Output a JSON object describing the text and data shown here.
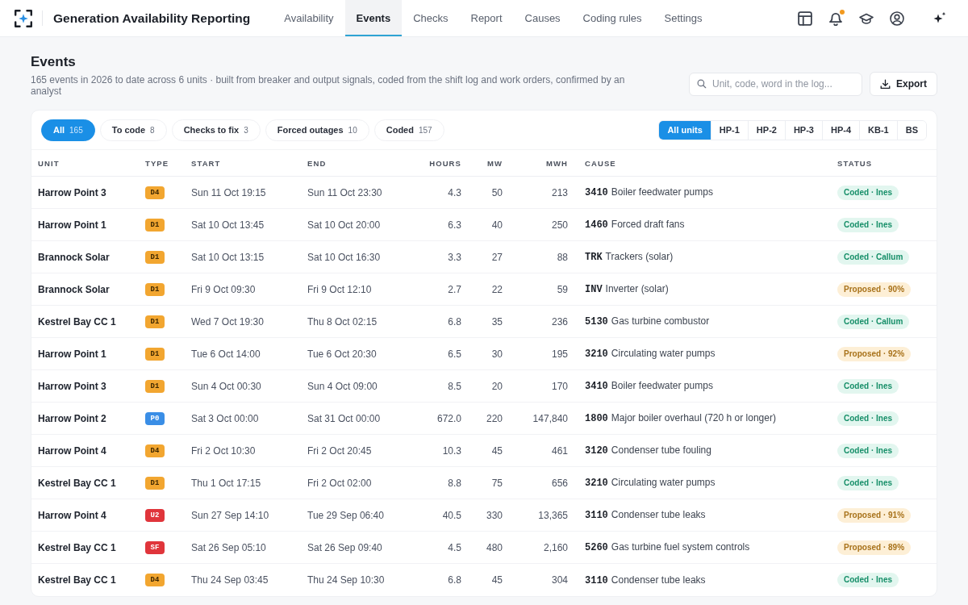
{
  "app": {
    "title": "Generation Availability Reporting",
    "notifications_unread": true
  },
  "nav": [
    {
      "label": "Availability",
      "selected": false
    },
    {
      "label": "Events",
      "selected": true
    },
    {
      "label": "Checks",
      "selected": false
    },
    {
      "label": "Report",
      "selected": false
    },
    {
      "label": "Causes",
      "selected": false
    },
    {
      "label": "Coding rules",
      "selected": false
    },
    {
      "label": "Settings",
      "selected": false
    }
  ],
  "page": {
    "title": "Events",
    "subtitle": "165 events in 2026 to date across 6 units · built from breaker and output signals, coded from the shift log and work orders, confirmed by an analyst",
    "search": {
      "placeholder": "Unit, code, word in the log..."
    },
    "export_button": "Export"
  },
  "filters": [
    {
      "label": "All",
      "count": "165",
      "selected": true
    },
    {
      "label": "To code",
      "count": "8",
      "selected": false
    },
    {
      "label": "Checks to fix",
      "count": "3",
      "selected": false
    },
    {
      "label": "Forced outages",
      "count": "10",
      "selected": false
    },
    {
      "label": "Coded",
      "count": "157",
      "selected": false
    }
  ],
  "unit_filter": [
    {
      "label": "All units",
      "selected": true
    },
    {
      "label": "HP-1",
      "selected": false
    },
    {
      "label": "HP-2",
      "selected": false
    },
    {
      "label": "HP-3",
      "selected": false
    },
    {
      "label": "HP-4",
      "selected": false
    },
    {
      "label": "KB-1",
      "selected": false
    },
    {
      "label": "BS",
      "selected": false
    }
  ],
  "table": {
    "columns": [
      "UNIT",
      "TYPE",
      "START",
      "END",
      "HOURS",
      "MW",
      "MWH",
      "CAUSE",
      "STATUS"
    ],
    "rows": [
      {
        "unit": "Harrow Point 3",
        "type": {
          "code": "D4",
          "color": "#f2a630"
        },
        "start": "Sun 11 Oct 19:15",
        "end": "Sun 11 Oct 23:30",
        "hours": "4.3",
        "mw": "50",
        "mwh": "213",
        "cause": {
          "code": "3410",
          "text": "Boiler feedwater pumps"
        },
        "status": {
          "kind": "coded",
          "label": "Coded · Ines"
        }
      },
      {
        "unit": "Harrow Point 1",
        "type": {
          "code": "D1",
          "color": "#f2a630"
        },
        "start": "Sat 10 Oct 13:45",
        "end": "Sat 10 Oct 20:00",
        "hours": "6.3",
        "mw": "40",
        "mwh": "250",
        "cause": {
          "code": "1460",
          "text": "Forced draft fans"
        },
        "status": {
          "kind": "coded",
          "label": "Coded · Ines"
        }
      },
      {
        "unit": "Brannock Solar",
        "type": {
          "code": "D1",
          "color": "#f2a630"
        },
        "start": "Sat 10 Oct 13:15",
        "end": "Sat 10 Oct 16:30",
        "hours": "3.3",
        "mw": "27",
        "mwh": "88",
        "cause": {
          "code": "TRK",
          "text": "Trackers (solar)"
        },
        "status": {
          "kind": "coded",
          "label": "Coded · Callum"
        }
      },
      {
        "unit": "Brannock Solar",
        "type": {
          "code": "D1",
          "color": "#f2a630"
        },
        "start": "Fri 9 Oct 09:30",
        "end": "Fri 9 Oct 12:10",
        "hours": "2.7",
        "mw": "22",
        "mwh": "59",
        "cause": {
          "code": "INV",
          "text": "Inverter (solar)"
        },
        "status": {
          "kind": "proposed",
          "label": "Proposed · 90%"
        }
      },
      {
        "unit": "Kestrel Bay CC 1",
        "type": {
          "code": "D1",
          "color": "#f2a630"
        },
        "start": "Wed 7 Oct 19:30",
        "end": "Thu 8 Oct 02:15",
        "hours": "6.8",
        "mw": "35",
        "mwh": "236",
        "cause": {
          "code": "5130",
          "text": "Gas turbine combustor"
        },
        "status": {
          "kind": "coded",
          "label": "Coded · Callum"
        }
      },
      {
        "unit": "Harrow Point 1",
        "type": {
          "code": "D1",
          "color": "#f2a630"
        },
        "start": "Tue 6 Oct 14:00",
        "end": "Tue 6 Oct 20:30",
        "hours": "6.5",
        "mw": "30",
        "mwh": "195",
        "cause": {
          "code": "3210",
          "text": "Circulating water pumps"
        },
        "status": {
          "kind": "proposed",
          "label": "Proposed · 92%"
        }
      },
      {
        "unit": "Harrow Point 3",
        "type": {
          "code": "D1",
          "color": "#f2a630"
        },
        "start": "Sun 4 Oct 00:30",
        "end": "Sun 4 Oct 09:00",
        "hours": "8.5",
        "mw": "20",
        "mwh": "170",
        "cause": {
          "code": "3410",
          "text": "Boiler feedwater pumps"
        },
        "status": {
          "kind": "coded",
          "label": "Coded · Ines"
        }
      },
      {
        "unit": "Harrow Point 2",
        "type": {
          "code": "P0",
          "color": "#3a8ee6"
        },
        "start": "Sat 3 Oct 00:00",
        "end": "Sat 31 Oct 00:00",
        "hours": "672.0",
        "mw": "220",
        "mwh": "147,840",
        "cause": {
          "code": "1800",
          "text": "Major boiler overhaul (720 h or longer)"
        },
        "status": {
          "kind": "coded",
          "label": "Coded · Ines"
        }
      },
      {
        "unit": "Harrow Point 4",
        "type": {
          "code": "D4",
          "color": "#f2a630"
        },
        "start": "Fri 2 Oct 10:30",
        "end": "Fri 2 Oct 20:45",
        "hours": "10.3",
        "mw": "45",
        "mwh": "461",
        "cause": {
          "code": "3120",
          "text": "Condenser tube fouling"
        },
        "status": {
          "kind": "coded",
          "label": "Coded · Ines"
        }
      },
      {
        "unit": "Kestrel Bay CC 1",
        "type": {
          "code": "D1",
          "color": "#f2a630"
        },
        "start": "Thu 1 Oct 17:15",
        "end": "Fri 2 Oct 02:00",
        "hours": "8.8",
        "mw": "75",
        "mwh": "656",
        "cause": {
          "code": "3210",
          "text": "Circulating water pumps"
        },
        "status": {
          "kind": "coded",
          "label": "Coded · Ines"
        }
      },
      {
        "unit": "Harrow Point 4",
        "type": {
          "code": "U2",
          "color": "#e0353b"
        },
        "start": "Sun 27 Sep 14:10",
        "end": "Tue 29 Sep 06:40",
        "hours": "40.5",
        "mw": "330",
        "mwh": "13,365",
        "cause": {
          "code": "3110",
          "text": "Condenser tube leaks"
        },
        "status": {
          "kind": "proposed",
          "label": "Proposed · 91%"
        }
      },
      {
        "unit": "Kestrel Bay CC 1",
        "type": {
          "code": "SF",
          "color": "#e0353b"
        },
        "start": "Sat 26 Sep 05:10",
        "end": "Sat 26 Sep 09:40",
        "hours": "4.5",
        "mw": "480",
        "mwh": "2,160",
        "cause": {
          "code": "5260",
          "text": "Gas turbine fuel system controls"
        },
        "status": {
          "kind": "proposed",
          "label": "Proposed · 89%"
        }
      },
      {
        "unit": "Kestrel Bay CC 1",
        "type": {
          "code": "D4",
          "color": "#f2a630"
        },
        "start": "Thu 24 Sep 03:45",
        "end": "Thu 24 Sep 10:30",
        "hours": "6.8",
        "mw": "45",
        "mwh": "304",
        "cause": {
          "code": "3110",
          "text": "Condenser tube leaks"
        },
        "status": {
          "kind": "coded",
          "label": "Coded · Ines"
        }
      }
    ]
  }
}
